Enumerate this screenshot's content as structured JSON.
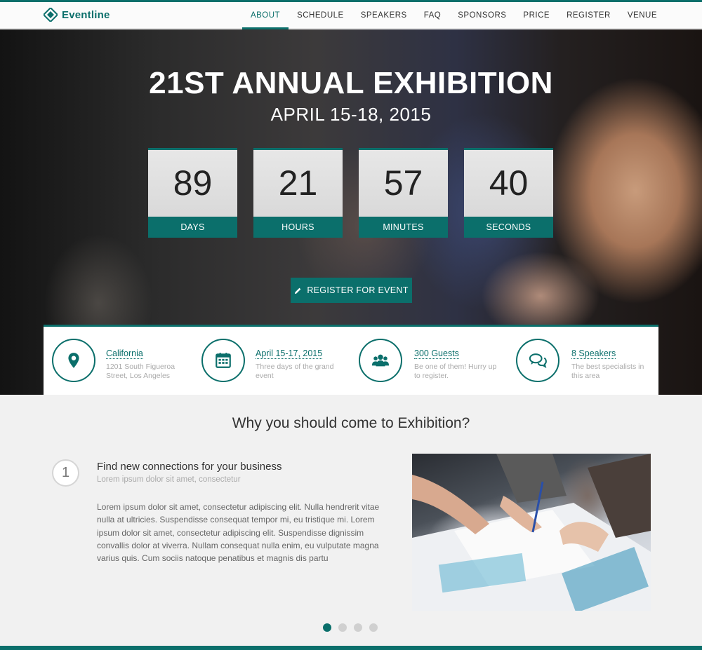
{
  "brand": {
    "name": "Eventline",
    "color": "#0b6f6b"
  },
  "nav": {
    "items": [
      {
        "label": "ABOUT",
        "active": true
      },
      {
        "label": "SCHEDULE"
      },
      {
        "label": "SPEAKERS"
      },
      {
        "label": "FAQ"
      },
      {
        "label": "SPONSORS"
      },
      {
        "label": "PRICE"
      },
      {
        "label": "REGISTER"
      },
      {
        "label": "VENUE"
      }
    ]
  },
  "hero": {
    "title": "21ST ANNUAL EXHIBITION",
    "date": "APRIL 15-18, 2015",
    "countdown": [
      {
        "value": "89",
        "label": "DAYS"
      },
      {
        "value": "21",
        "label": "HOURS"
      },
      {
        "value": "57",
        "label": "MINUTES"
      },
      {
        "value": "40",
        "label": "SECONDS"
      }
    ],
    "register_label": "REGISTER FOR EVENT"
  },
  "info": [
    {
      "icon": "map-marker-icon",
      "title": "California",
      "desc": "1201 South Figueroa Street, Los Angeles"
    },
    {
      "icon": "calendar-icon",
      "title": "April 15-17, 2015",
      "desc": "Three days of the grand event"
    },
    {
      "icon": "users-icon",
      "title": "300 Guests",
      "desc": "Be one of them! Hurry up to register."
    },
    {
      "icon": "chat-bubbles-icon",
      "title": "8 Speakers",
      "desc": "The best specialists in this area"
    }
  ],
  "why": {
    "title": "Why you should come to Exhibition?",
    "step_number": "1",
    "step_title": "Find new connections for your business",
    "step_subtitle": "Lorem ipsum dolor sit amet, consectetur",
    "step_body": "Lorem ipsum dolor sit amet, consectetur adipiscing elit. Nulla hendrerit vitae nulla at ultricies. Suspendisse consequat tempor mi, eu tristique mi. Lorem ipsum dolor sit amet, consectetur adipiscing elit. Suspendisse dignissim convallis dolor at viverra. Nullam consequat nulla enim, eu vulputate magna varius quis. Cum sociis natoque penatibus et magnis dis partu",
    "slider_active_index": 0,
    "slider_count": 4
  }
}
